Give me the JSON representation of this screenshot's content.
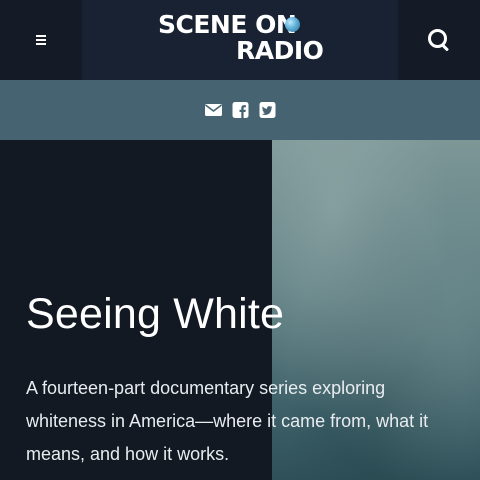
{
  "header": {
    "logo": {
      "line1": "SCENE ON",
      "line2": "RADIO",
      "globe_icon": "globe-icon"
    },
    "menu_icon": "hamburger-menu-icon",
    "search_icon": "search-icon"
  },
  "social": {
    "icons": [
      "envelope-icon",
      "facebook-icon",
      "twitter-icon"
    ]
  },
  "hero": {
    "title": "Seeing White",
    "description": "A fourteen-part documentary series exploring whiteness in America—where it came from, what it means, and how it works."
  },
  "colors": {
    "header_background": "#141b26",
    "logo_background": "#182233",
    "social_bar_background": "#466371",
    "hero_background": "#121923",
    "text": "#ffffff"
  }
}
